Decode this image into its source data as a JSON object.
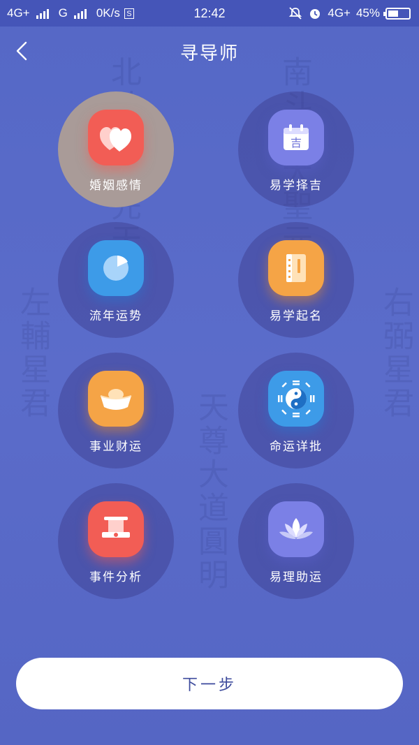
{
  "status_bar": {
    "network_left": "4G+",
    "network_mid": "G",
    "speed": "0K/s",
    "s_badge": "S",
    "time": "12:42",
    "network_right": "4G+",
    "battery": "45%",
    "icons": [
      "mute-icon",
      "alarm-icon",
      "battery-icon"
    ]
  },
  "header": {
    "title": "寻导师",
    "back_icon": "chevron-left-icon"
  },
  "background_chars": [
    "北斗天聖先天斗",
    "南斗陽大聖元君",
    "右弼星君",
    "左輔星君",
    "天尊大道圓明"
  ],
  "items": [
    {
      "label": "婚姻感情",
      "icon": "hearts-icon",
      "color": "#f25d55",
      "selected": true
    },
    {
      "label": "易学择吉",
      "icon": "calendar-icon",
      "color": "#7b80e6",
      "selected": false
    },
    {
      "label": "流年运势",
      "icon": "pie-clock-icon",
      "color": "#3d9be8",
      "selected": false
    },
    {
      "label": "易学起名",
      "icon": "book-icon",
      "color": "#f5a446",
      "selected": false
    },
    {
      "label": "事业财运",
      "icon": "gold-ingot-icon",
      "color": "#f5a446",
      "selected": false
    },
    {
      "label": "命运详批",
      "icon": "bagua-icon",
      "color": "#3d9be8",
      "selected": false
    },
    {
      "label": "事件分析",
      "icon": "official-hat-icon",
      "color": "#f25d55",
      "selected": false
    },
    {
      "label": "易理助运",
      "icon": "lotus-icon",
      "color": "#7b80e6",
      "selected": false
    }
  ],
  "next_button": {
    "label": "下一步"
  }
}
